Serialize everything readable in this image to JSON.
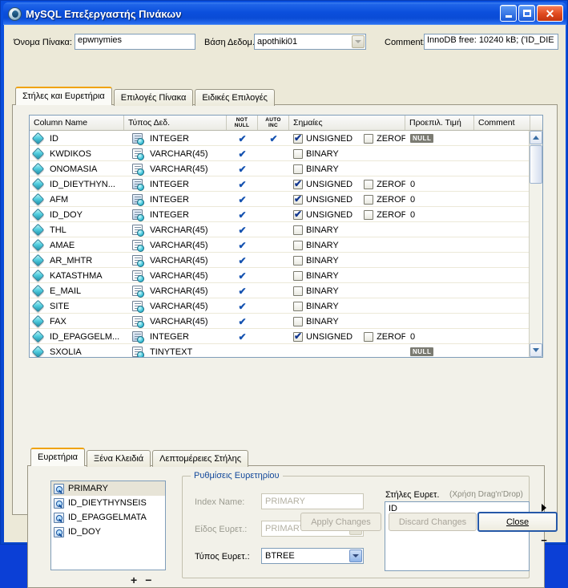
{
  "window": {
    "title": "MySQL Επεξεργαστής Πινάκων",
    "icon": "mysql-dolphin-icon",
    "minimize_label": "",
    "maximize_label": "",
    "close_label": "✕"
  },
  "header": {
    "table_name_label": "Όνομα Πίνακα:",
    "table_name_value": "epwnymies",
    "database_label": "Βάση Δεδομ.:",
    "database_value": "apothiki01",
    "comment_label": "Comment:",
    "comment_value": "InnoDB free: 10240 kB; ('ID_DIE"
  },
  "tabs": [
    {
      "label": "Στήλες και Ευρετήρια",
      "active": true
    },
    {
      "label": "Επιλογές Πίνακα",
      "active": false
    },
    {
      "label": "Ειδικές Επιλογές",
      "active": false
    }
  ],
  "grid": {
    "headers": {
      "column_name": "Column Name",
      "datatype": "Τύπος Δεδ.",
      "not_null_line1": "NOT",
      "not_null_line2": "NULL",
      "auto_inc_line1": "AUTO",
      "auto_inc_line2": "INC",
      "flags": "Σημαίες",
      "default_value": "Προεπιλ. Τιμή",
      "comment": "Comment"
    },
    "rows": [
      {
        "name": "ID",
        "type": "INTEGER",
        "numeric": true,
        "not_null": true,
        "auto_inc": true,
        "flag1": "UNSIGNED",
        "flag1_on": true,
        "flag2": "ZEROFILL",
        "flag2_on": false,
        "default": "NULL",
        "default_is_badge": true,
        "comment": ""
      },
      {
        "name": "KWDIKOS",
        "type": "VARCHAR(45)",
        "numeric": false,
        "not_null": true,
        "auto_inc": false,
        "flag1": "BINARY",
        "flag1_on": false,
        "flag2": "",
        "flag2_on": false,
        "default": "",
        "default_is_badge": false,
        "comment": ""
      },
      {
        "name": "ONOMASIA",
        "type": "VARCHAR(45)",
        "numeric": false,
        "not_null": true,
        "auto_inc": false,
        "flag1": "BINARY",
        "flag1_on": false,
        "flag2": "",
        "flag2_on": false,
        "default": "",
        "default_is_badge": false,
        "comment": ""
      },
      {
        "name": "ID_DIEYTHYN...",
        "type": "INTEGER",
        "numeric": true,
        "not_null": true,
        "auto_inc": false,
        "flag1": "UNSIGNED",
        "flag1_on": true,
        "flag2": "ZEROFILL",
        "flag2_on": false,
        "default": "0",
        "default_is_badge": false,
        "comment": ""
      },
      {
        "name": "AFM",
        "type": "INTEGER",
        "numeric": true,
        "not_null": true,
        "auto_inc": false,
        "flag1": "UNSIGNED",
        "flag1_on": true,
        "flag2": "ZEROFILL",
        "flag2_on": false,
        "default": "0",
        "default_is_badge": false,
        "comment": ""
      },
      {
        "name": "ID_DOY",
        "type": "INTEGER",
        "numeric": true,
        "not_null": true,
        "auto_inc": false,
        "flag1": "UNSIGNED",
        "flag1_on": true,
        "flag2": "ZEROFILL",
        "flag2_on": false,
        "default": "0",
        "default_is_badge": false,
        "comment": ""
      },
      {
        "name": "THL",
        "type": "VARCHAR(45)",
        "numeric": false,
        "not_null": true,
        "auto_inc": false,
        "flag1": "BINARY",
        "flag1_on": false,
        "flag2": "",
        "flag2_on": false,
        "default": "",
        "default_is_badge": false,
        "comment": ""
      },
      {
        "name": "AMAE",
        "type": "VARCHAR(45)",
        "numeric": false,
        "not_null": true,
        "auto_inc": false,
        "flag1": "BINARY",
        "flag1_on": false,
        "flag2": "",
        "flag2_on": false,
        "default": "",
        "default_is_badge": false,
        "comment": ""
      },
      {
        "name": "AR_MHTR",
        "type": "VARCHAR(45)",
        "numeric": false,
        "not_null": true,
        "auto_inc": false,
        "flag1": "BINARY",
        "flag1_on": false,
        "flag2": "",
        "flag2_on": false,
        "default": "",
        "default_is_badge": false,
        "comment": ""
      },
      {
        "name": "KATASTHMA",
        "type": "VARCHAR(45)",
        "numeric": false,
        "not_null": true,
        "auto_inc": false,
        "flag1": "BINARY",
        "flag1_on": false,
        "flag2": "",
        "flag2_on": false,
        "default": "",
        "default_is_badge": false,
        "comment": ""
      },
      {
        "name": "E_MAIL",
        "type": "VARCHAR(45)",
        "numeric": false,
        "not_null": true,
        "auto_inc": false,
        "flag1": "BINARY",
        "flag1_on": false,
        "flag2": "",
        "flag2_on": false,
        "default": "",
        "default_is_badge": false,
        "comment": ""
      },
      {
        "name": "SITE",
        "type": "VARCHAR(45)",
        "numeric": false,
        "not_null": true,
        "auto_inc": false,
        "flag1": "BINARY",
        "flag1_on": false,
        "flag2": "",
        "flag2_on": false,
        "default": "",
        "default_is_badge": false,
        "comment": ""
      },
      {
        "name": "FAX",
        "type": "VARCHAR(45)",
        "numeric": false,
        "not_null": true,
        "auto_inc": false,
        "flag1": "BINARY",
        "flag1_on": false,
        "flag2": "",
        "flag2_on": false,
        "default": "",
        "default_is_badge": false,
        "comment": ""
      },
      {
        "name": "ID_EPAGGELM...",
        "type": "INTEGER",
        "numeric": true,
        "not_null": true,
        "auto_inc": false,
        "flag1": "UNSIGNED",
        "flag1_on": true,
        "flag2": "ZEROFILL",
        "flag2_on": false,
        "default": "0",
        "default_is_badge": false,
        "comment": ""
      },
      {
        "name": "SXOLIA",
        "type": "TINYTEXT",
        "numeric": false,
        "not_null": false,
        "auto_inc": false,
        "flag1": "",
        "flag1_on": false,
        "flag2": "",
        "flag2_on": false,
        "default": "NULL",
        "default_is_badge": true,
        "comment": ""
      }
    ]
  },
  "subtabs": [
    {
      "label": "Ευρετήρια",
      "active": true
    },
    {
      "label": "Ξένα Κλειδιά",
      "active": false
    },
    {
      "label": "Λεπτομέρειες Στήλης",
      "active": false
    }
  ],
  "indexes": {
    "list": [
      {
        "name": "PRIMARY",
        "selected": true
      },
      {
        "name": "ID_DIEYTHYNSEIS",
        "selected": false
      },
      {
        "name": "ID_EPAGGELMATA",
        "selected": false
      },
      {
        "name": "ID_DOY",
        "selected": false
      }
    ],
    "add_label": "+",
    "remove_label": "−",
    "settings_title": "Ρυθμίσεις Ευρετηρίου",
    "index_name_label": "Index Name:",
    "index_name_value": "PRIMARY",
    "index_kind_label": "Είδος Ευρετ.:",
    "index_kind_value": "PRIMARY",
    "index_type_label": "Τύπος Ευρετ.:",
    "index_type_value": "BTREE",
    "columns_label": "Στήλες Ευρετ.",
    "columns_hint": "(Χρήση Drag'n'Drop)",
    "columns_values": "ID",
    "col_add_label": "+",
    "col_remove_label": "−"
  },
  "footer": {
    "apply_label": "Apply Changes",
    "discard_label": "Discard Changes",
    "close_label": "Close"
  },
  "colors": {
    "title_blue": "#0b4fdc",
    "dialog_face": "#ece9d8",
    "accent_orange": "#f0a30a",
    "check_blue": "#1552b0",
    "group_title": "#12489a"
  }
}
